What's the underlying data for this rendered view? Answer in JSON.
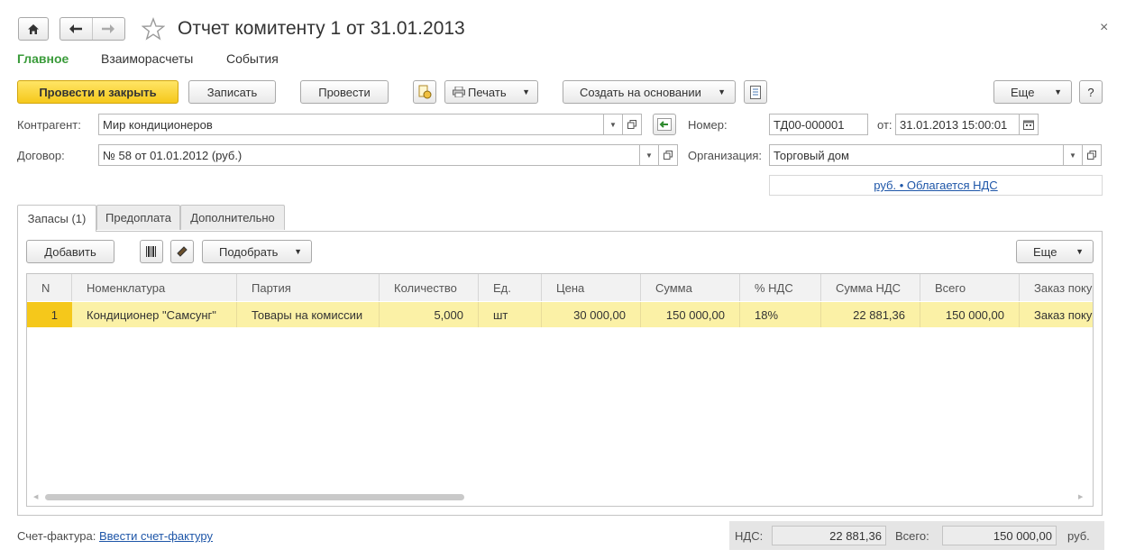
{
  "window": {
    "title": "Отчет комитенту 1 от 31.01.2013"
  },
  "nav_tabs": [
    {
      "label": "Главное"
    },
    {
      "label": "Взаиморасчеты"
    },
    {
      "label": "События"
    }
  ],
  "toolbar": {
    "post_close": "Провести и закрыть",
    "save": "Записать",
    "post": "Провести",
    "print": "Печать",
    "create_based": "Создать на основании",
    "more": "Еще",
    "help": "?"
  },
  "form": {
    "counterparty_label": "Контрагент:",
    "counterparty_value": "Мир кондиционеров",
    "contract_label": "Договор:",
    "contract_value": "№ 58 от 01.01.2012 (руб.)",
    "number_label": "Номер:",
    "number_value": "ТД00-000001",
    "date_label": "от:",
    "date_value": "31.01.2013 15:00:01",
    "org_label": "Организация:",
    "org_value": "Торговый дом",
    "vat_link": "руб. • Облагается НДС"
  },
  "doc_tabs": [
    {
      "label": "Запасы (1)"
    },
    {
      "label": "Предоплата"
    },
    {
      "label": "Дополнительно"
    }
  ],
  "table_toolbar": {
    "add": "Добавить",
    "pick": "Подобрать",
    "more": "Еще"
  },
  "table": {
    "columns": [
      "N",
      "Номенклатура",
      "Партия",
      "Количество",
      "Ед.",
      "Цена",
      "Сумма",
      "% НДС",
      "Сумма НДС",
      "Всего",
      "Заказ покупателя"
    ],
    "rows": [
      [
        "1",
        "Кондиционер \"Самсунг\"",
        "Товары на комиссии",
        "5,000",
        "шт",
        "30 000,00",
        "150 000,00",
        "18%",
        "22 881,36",
        "150 000,00",
        "Заказ покупателя"
      ]
    ]
  },
  "footer": {
    "invoice_label": "Счет-фактура:",
    "invoice_link": "Ввести счет-фактуру",
    "vat_label": "НДС:",
    "vat_value": "22 881,36",
    "total_label": "Всего:",
    "total_value": "150 000,00",
    "currency": "руб."
  },
  "colors": {
    "accent_green": "#3a9b3a",
    "primary_button": "#f5c81b",
    "selected_row": "#fbf1a6",
    "link": "#1e56a8"
  }
}
